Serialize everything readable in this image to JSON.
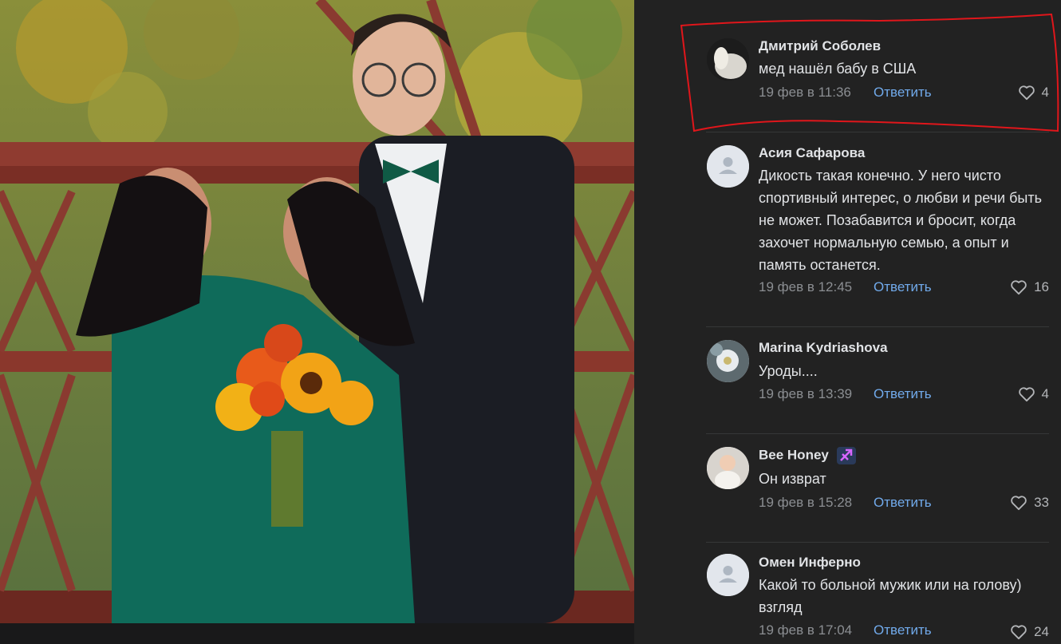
{
  "comments": [
    {
      "author": "Дмитрий Соболев",
      "text": "мед нашёл бабу в США",
      "time": "19 фев в 11:36",
      "reply": "Ответить",
      "likes": "4",
      "avatar": "photo-avatar-icon"
    },
    {
      "author": "Асия Сафарова",
      "text": "Дикость такая конечно. У него чисто спортивный интерес, о любви и речи быть не может. Позабавится и бросит, когда захочет нормальную семью, а опыт и память останется.",
      "time": "19 фев в 12:45",
      "reply": "Ответить",
      "likes": "16",
      "avatar": "default-user-icon"
    },
    {
      "author": "Marina Kydriashova",
      "text": "Уроды....",
      "time": "19 фев в 13:39",
      "reply": "Ответить",
      "likes": "4",
      "avatar": "flower-avatar-icon"
    },
    {
      "author": "Bee Honey",
      "text": "Он изврат",
      "time": "19 фев в 15:28",
      "reply": "Ответить",
      "likes": "33",
      "avatar": "baby-avatar-icon"
    },
    {
      "author": "Омен Инферно",
      "text": "Какой то больной мужик или на голову) взгляд",
      "time": "19 фев в 17:04",
      "reply": "Ответить",
      "likes": "24",
      "avatar": "default-user-icon"
    }
  ],
  "colors": {
    "background": "#222222",
    "text": "#e1e3e6",
    "meta": "#8b8e92",
    "link": "#71aaeb",
    "highlight": "#e0161b"
  }
}
